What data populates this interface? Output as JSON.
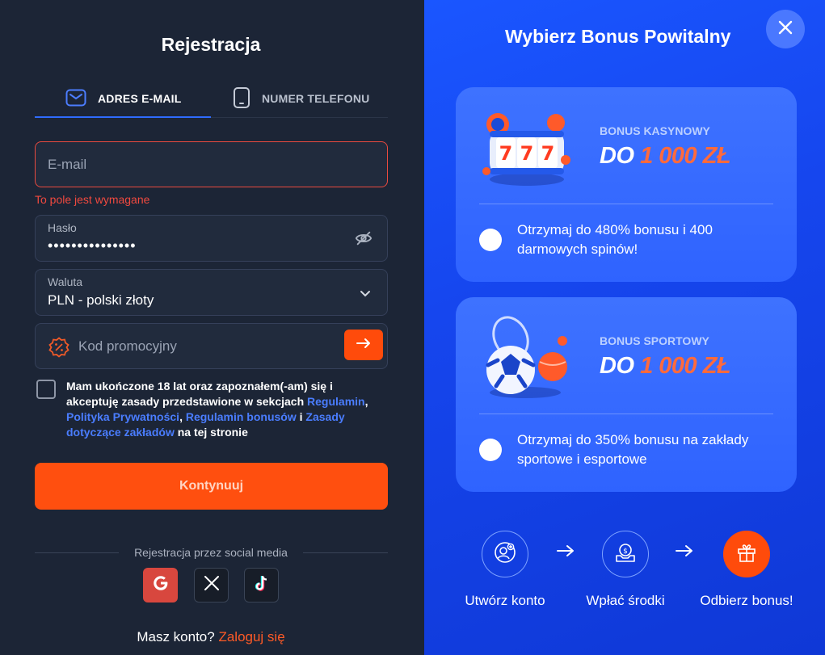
{
  "left": {
    "title": "Rejestracja",
    "tabs": [
      {
        "label": "ADRES E-MAIL",
        "icon": "envelope-icon",
        "active": true
      },
      {
        "label": "NUMER TELEFONU",
        "icon": "phone-icon",
        "active": false
      }
    ],
    "email": {
      "placeholder": "E-mail",
      "error": "To pole jest wymagane"
    },
    "password": {
      "label": "Hasło",
      "value": "•••••••••••••••"
    },
    "currency": {
      "label": "Waluta",
      "value": "PLN - polski złoty"
    },
    "promo": {
      "placeholder": "Kod promocyjny"
    },
    "terms": {
      "text1": "Mam ukończone 18 lat oraz zapoznałem(-am) się i akceptuję zasady przedstawione w sekcjach ",
      "link1": "Regulamin",
      "sep1": ", ",
      "link2": "Polityka Prywatności",
      "sep2": ", ",
      "link3": "Regulamin bonusów",
      "sep3": " i ",
      "link4": "Zasady dotyczące zakładów",
      "text2": " na tej stronie"
    },
    "continue_label": "Kontynuuj",
    "social_label": "Rejestracja przez social media",
    "social": [
      "google-icon",
      "x-icon",
      "tiktok-icon"
    ],
    "login_text": "Masz konto?",
    "login_link": "Zaloguj się"
  },
  "right": {
    "title": "Wybierz Bonus Powitalny",
    "cards": [
      {
        "tag": "BONUS KASYNOWY",
        "prefix": "DO",
        "amount": "1 000 ZŁ",
        "desc": "Otrzymaj do 480% bonusu i 400 darmowych spinów!"
      },
      {
        "tag": "BONUS SPORTOWY",
        "prefix": "DO",
        "amount": "1 000 ZŁ",
        "desc": "Otrzymaj do 350% bonusu na zakłady sportowe i esportowe"
      }
    ],
    "steps": [
      {
        "label": "Utwórz konto",
        "icon": "add-user-icon"
      },
      {
        "label": "Wpłać środki",
        "icon": "deposit-icon"
      },
      {
        "label": "Odbierz bonus!",
        "icon": "gift-icon"
      }
    ]
  },
  "colors": {
    "accent": "#ff4f0f",
    "link": "#4a7dff",
    "error": "#f0493f",
    "panel_blue": "#1a56ff"
  }
}
